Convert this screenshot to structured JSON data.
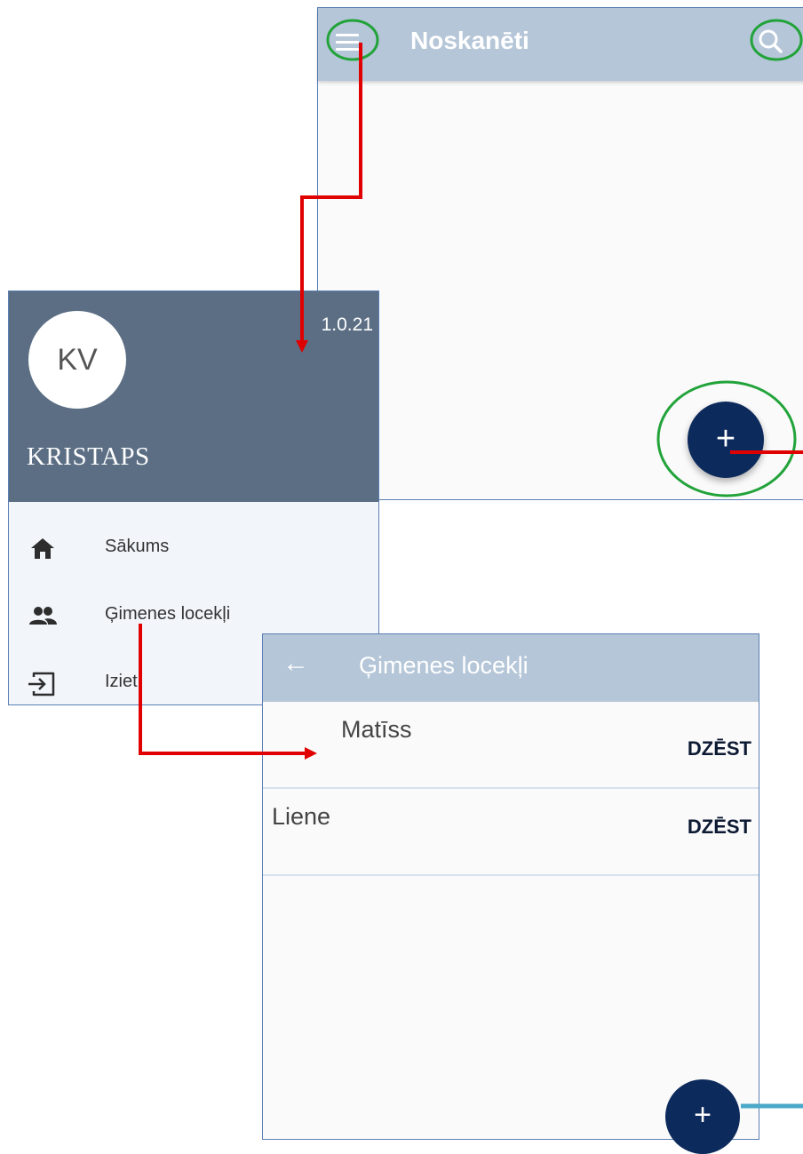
{
  "main_screen": {
    "title": "Noskanēti",
    "menu_icon": "hamburger-menu-icon",
    "search_icon": "search-icon",
    "fab_label": "+"
  },
  "drawer": {
    "avatar_initials": "KV",
    "version": "1.0.21",
    "user_name": "KRISTAPS",
    "items": [
      {
        "label": "Sākums",
        "icon": "home-icon"
      },
      {
        "label": "Ģimenes locekļi",
        "icon": "people-icon"
      },
      {
        "label": "Iziet",
        "icon": "exit-icon"
      }
    ]
  },
  "family_screen": {
    "title": "Ģimenes locekļi",
    "back_icon": "back-arrow-icon",
    "members": [
      {
        "name": "Matīss",
        "action": "DZĒST"
      },
      {
        "name": "Liene",
        "action": "DZĒST"
      }
    ],
    "fab_label": "+"
  },
  "colors": {
    "appbar": "#b5c6d8",
    "drawer_header": "#5b6e84",
    "fab": "#0d2a5c",
    "arrow": "#e00000",
    "highlight": "#22a33a",
    "connector": "#4aa8c8"
  }
}
